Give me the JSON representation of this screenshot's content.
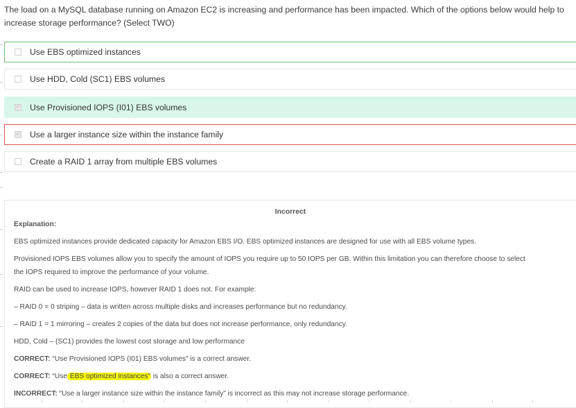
{
  "question": "The load on a MySQL database running on Amazon EC2 is increasing and performance has been impacted. Which of the options below would help to increase storage performance? (Select TWO)",
  "options": [
    {
      "label": "Use EBS optimized instances",
      "checked": false,
      "state": "correct-selected"
    },
    {
      "label": "Use HDD, Cold (SC1) EBS volumes",
      "checked": false,
      "state": "neutral"
    },
    {
      "label": "Use Provisioned IOPS (I01) EBS volumes",
      "checked": true,
      "state": "missed"
    },
    {
      "label": "Use a larger instance size within the instance family",
      "checked": true,
      "state": "wrong"
    },
    {
      "label": "Create a RAID 1 array from multiple EBS volumes",
      "checked": false,
      "state": "neutral"
    }
  ],
  "explanation": {
    "result": "Incorrect",
    "heading": "Explanation:",
    "p1": "EBS optimized instances provide dedicated capacity for Amazon EBS I/O. EBS optimized instances are designed for use with all EBS volume types.",
    "p2a": "Provisioned IOPS EBS volumes allow you to specify the amount of IOPS you require up to 50 IOPS per GB. Within this limitation you can therefore choose to select",
    "p2b": "the IOPS required to improve the performance of your volume.",
    "p3": "RAID can be used to increase IOPS, however RAID 1 does not. For example:",
    "p4": "– RAID 0 = 0 striping – data is written across multiple disks and increases performance but no redundancy.",
    "p5": "– RAID 1 = 1 mirroring – creates 2 copies of the data but does not increase performance, only redundancy.",
    "p6": "HDD, Cold – (SC1) provides the lowest cost storage and low performance",
    "c1_label": "CORRECT:",
    "c1_text": " “Use Provisioned IOPS (I01) EBS volumes” is a correct answer.",
    "c2_label": "CORRECT:",
    "c2_pre": " “Use",
    "c2_highlight": " EBS optimized instances”",
    "c2_post": " is also a correct answer.",
    "i1_label": "INCORRECT:",
    "i1_text": " “Use a larger instance size within the instance family” is incorrect as this may not increase storage performance."
  },
  "colors": {
    "correct_border": "#6fbf73",
    "missed_bg": "#d8f7ea",
    "wrong_border": "#d9534f",
    "highlight": "#f4f50a"
  }
}
